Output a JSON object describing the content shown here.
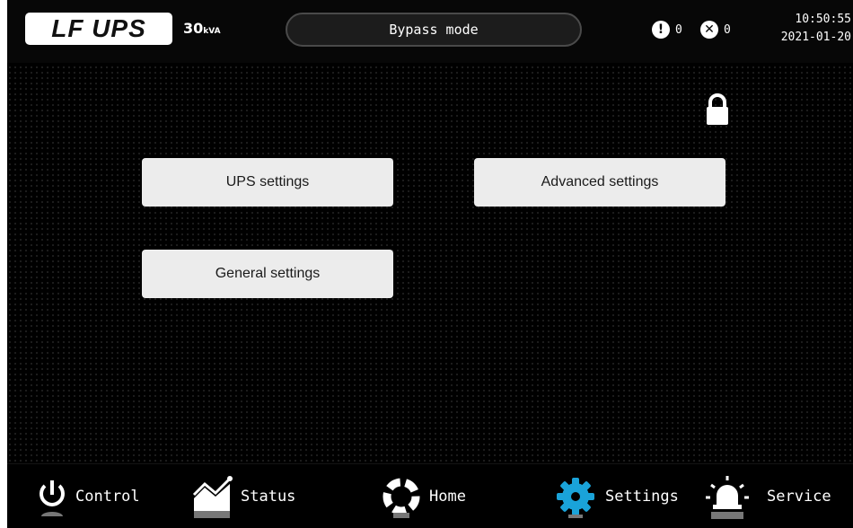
{
  "header": {
    "logo": "LF UPS",
    "capacity_value": "30",
    "capacity_unit": "kVA",
    "mode": "Bypass mode",
    "warning_count": "0",
    "fault_count": "0",
    "time": "10:50:55",
    "date": "2021-01-20"
  },
  "main": {
    "buttons": [
      {
        "label": "UPS settings"
      },
      {
        "label": "Advanced settings"
      },
      {
        "label": "General settings"
      }
    ]
  },
  "nav": {
    "items": [
      {
        "label": "Control",
        "icon": "power-icon"
      },
      {
        "label": "Status",
        "icon": "chart-icon"
      },
      {
        "label": "Home",
        "icon": "home-icon"
      },
      {
        "label": "Settings",
        "icon": "gear-icon",
        "active": true
      },
      {
        "label": "Service",
        "icon": "alarm-light-icon"
      }
    ]
  },
  "colors": {
    "background": "#000000",
    "button": "#ececec",
    "active_icon": "#1aa3d9"
  }
}
